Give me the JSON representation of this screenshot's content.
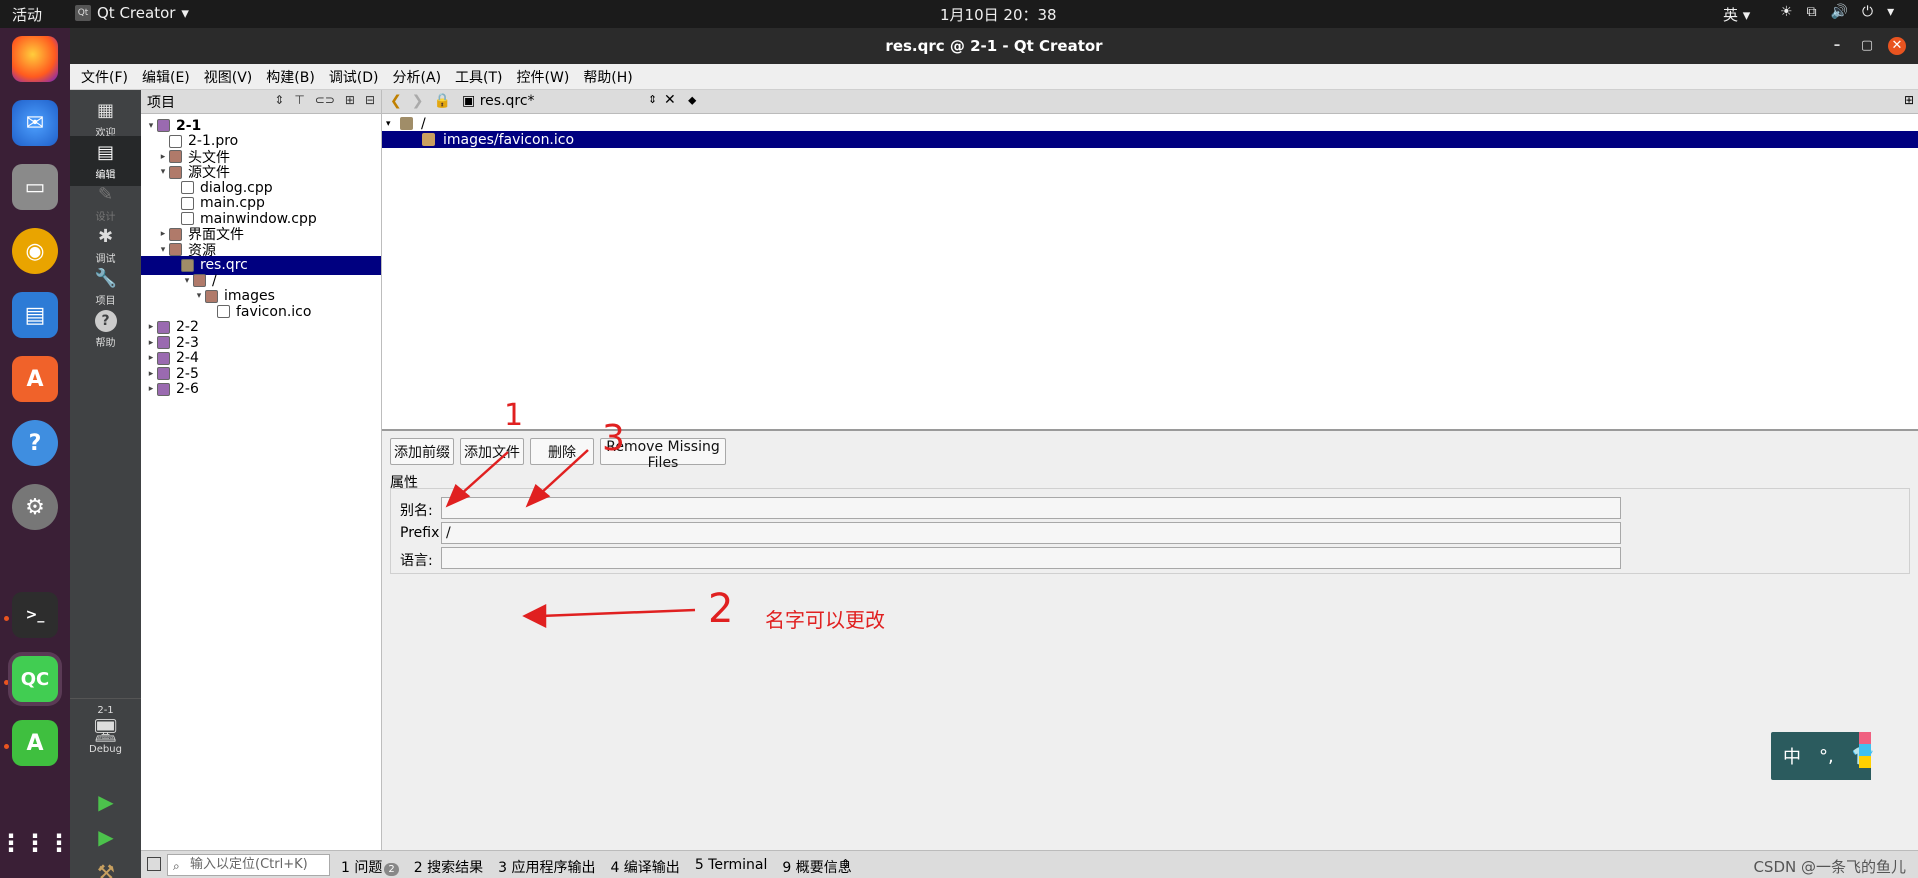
{
  "topbar": {
    "activities": "活动",
    "app_name": "Qt Creator",
    "clock": "1月10日  20：38",
    "ime": "英"
  },
  "window": {
    "title": "res.qrc @ 2-1 - Qt Creator"
  },
  "menu": [
    "文件(F)",
    "编辑(E)",
    "视图(V)",
    "构建(B)",
    "调试(D)",
    "分析(A)",
    "工具(T)",
    "控件(W)",
    "帮助(H)"
  ],
  "modes": [
    {
      "label": "欢迎",
      "icon": "grid-icon"
    },
    {
      "label": "编辑",
      "icon": "edit-icon",
      "active": true
    },
    {
      "label": "设计",
      "icon": "pencil-icon",
      "disabled": true
    },
    {
      "label": "调试",
      "icon": "bug-icon"
    },
    {
      "label": "项目",
      "icon": "wrench-icon"
    },
    {
      "label": "帮助",
      "icon": "help-icon"
    }
  ],
  "kit": {
    "project": "2-1",
    "config": "Debug"
  },
  "project_panel": {
    "title": "项目",
    "tree": [
      {
        "label": "2-1",
        "depth": 0,
        "arrow": "▾",
        "icon": "proj",
        "bold": true
      },
      {
        "label": "2-1.pro",
        "depth": 1,
        "arrow": "",
        "icon": "file"
      },
      {
        "label": "头文件",
        "depth": 1,
        "arrow": "▸",
        "icon": "folder"
      },
      {
        "label": "源文件",
        "depth": 1,
        "arrow": "▾",
        "icon": "folder"
      },
      {
        "label": "dialog.cpp",
        "depth": 2,
        "arrow": "",
        "icon": "file"
      },
      {
        "label": "main.cpp",
        "depth": 2,
        "arrow": "",
        "icon": "file"
      },
      {
        "label": "mainwindow.cpp",
        "depth": 2,
        "arrow": "",
        "icon": "file"
      },
      {
        "label": "界面文件",
        "depth": 1,
        "arrow": "▸",
        "icon": "folder"
      },
      {
        "label": "资源",
        "depth": 1,
        "arrow": "▾",
        "icon": "folder"
      },
      {
        "label": "res.qrc",
        "depth": 2,
        "arrow": "",
        "icon": "qrc",
        "selected": true
      },
      {
        "label": "/",
        "depth": 3,
        "arrow": "▾",
        "icon": "folder"
      },
      {
        "label": "images",
        "depth": 4,
        "arrow": "▾",
        "icon": "folder"
      },
      {
        "label": "favicon.ico",
        "depth": 5,
        "arrow": "",
        "icon": "file"
      },
      {
        "label": "2-2",
        "depth": 0,
        "arrow": "▸",
        "icon": "proj"
      },
      {
        "label": "2-3",
        "depth": 0,
        "arrow": "▸",
        "icon": "proj"
      },
      {
        "label": "2-4",
        "depth": 0,
        "arrow": "▸",
        "icon": "proj"
      },
      {
        "label": "2-5",
        "depth": 0,
        "arrow": "▸",
        "icon": "proj"
      },
      {
        "label": "2-6",
        "depth": 0,
        "arrow": "▸",
        "icon": "proj"
      }
    ]
  },
  "editor": {
    "file_tab": "res.qrc*",
    "qrc_tree": [
      {
        "label": "/",
        "depth": 0,
        "arrow": "▾"
      },
      {
        "label": "images/favicon.ico",
        "depth": 1,
        "arrow": "",
        "selected": true
      }
    ],
    "buttons": {
      "add_prefix": "添加前缀",
      "add_files": "添加文件",
      "remove": "删除",
      "remove_missing": "Remove Missing Files"
    },
    "properties": {
      "title": "属性",
      "alias_label": "别名:",
      "alias_value": "",
      "prefix_label": "Prefix:",
      "prefix_value": "/",
      "language_label": "语言:",
      "language_value": ""
    }
  },
  "annotations": {
    "num1": "1",
    "num2": "2",
    "num3": "3",
    "note": "名字可以更改",
    "color": "#e02020"
  },
  "ime_widget": {
    "lang": "中",
    "punct": "°,"
  },
  "output_bar": {
    "locator_placeholder": "输入以定位(Ctrl+K)",
    "tabs": [
      "1 问题",
      "2 搜索结果",
      "3 应用程序输出",
      "4 编译输出",
      "5 Terminal",
      "9 概要信息"
    ],
    "issues_count": "2",
    "watermark": "CSDN @一条飞的鱼儿"
  }
}
